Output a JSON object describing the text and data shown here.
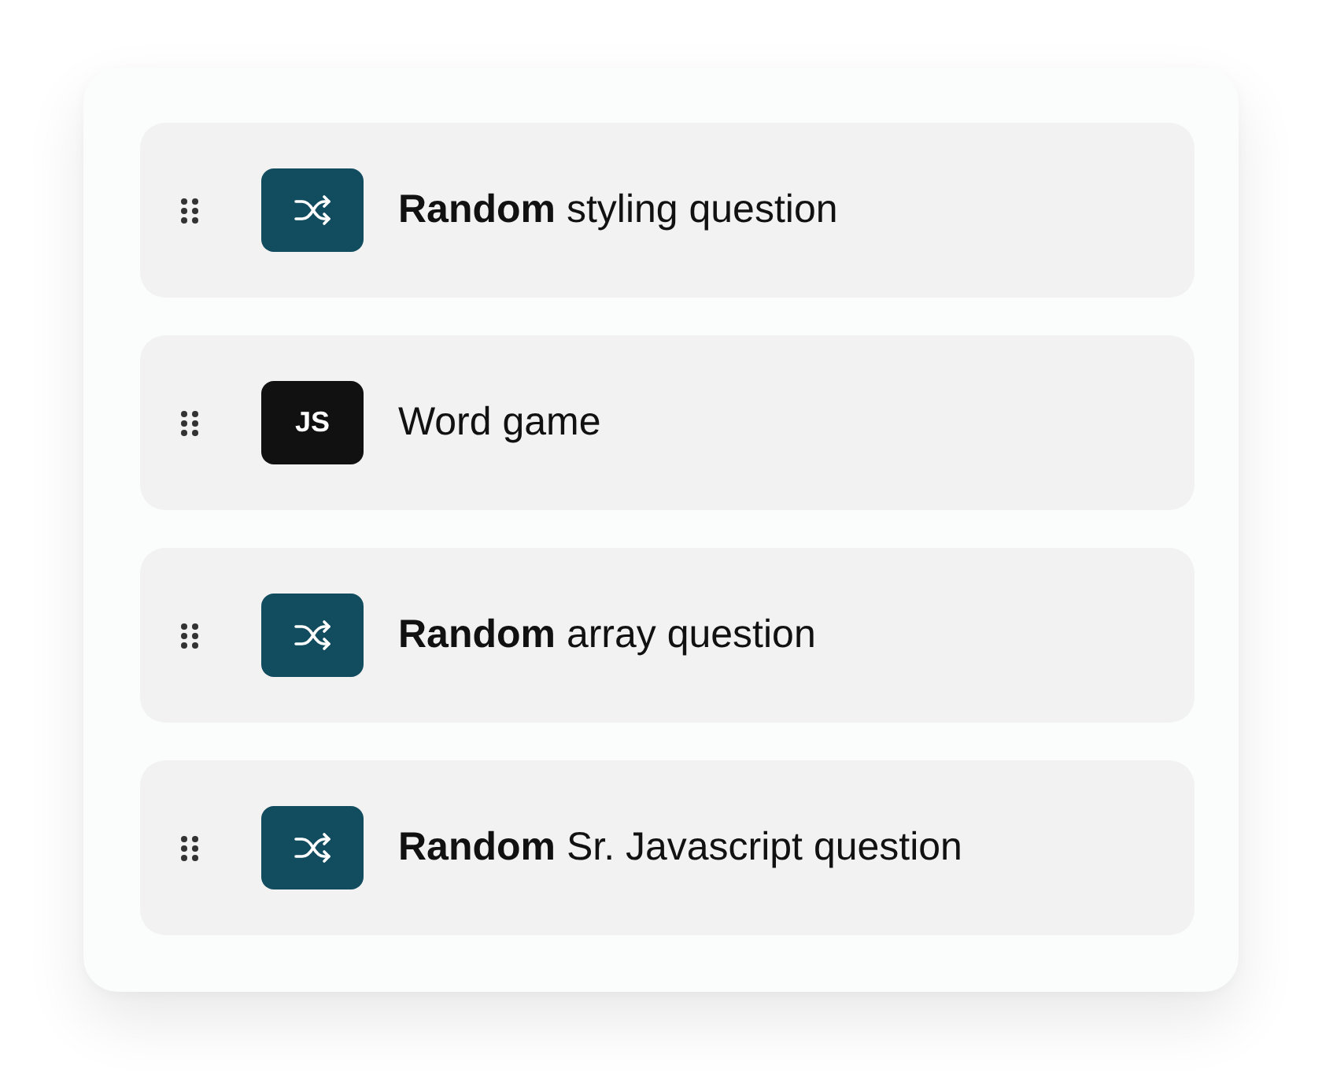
{
  "items": [
    {
      "kind": "random",
      "title": "**Random** styling question"
    },
    {
      "kind": "js",
      "badge": "JS",
      "title": "Word game"
    },
    {
      "kind": "random",
      "title": "**Random** array question"
    },
    {
      "kind": "random",
      "title": "**Random** Sr. Javascript question"
    }
  ]
}
